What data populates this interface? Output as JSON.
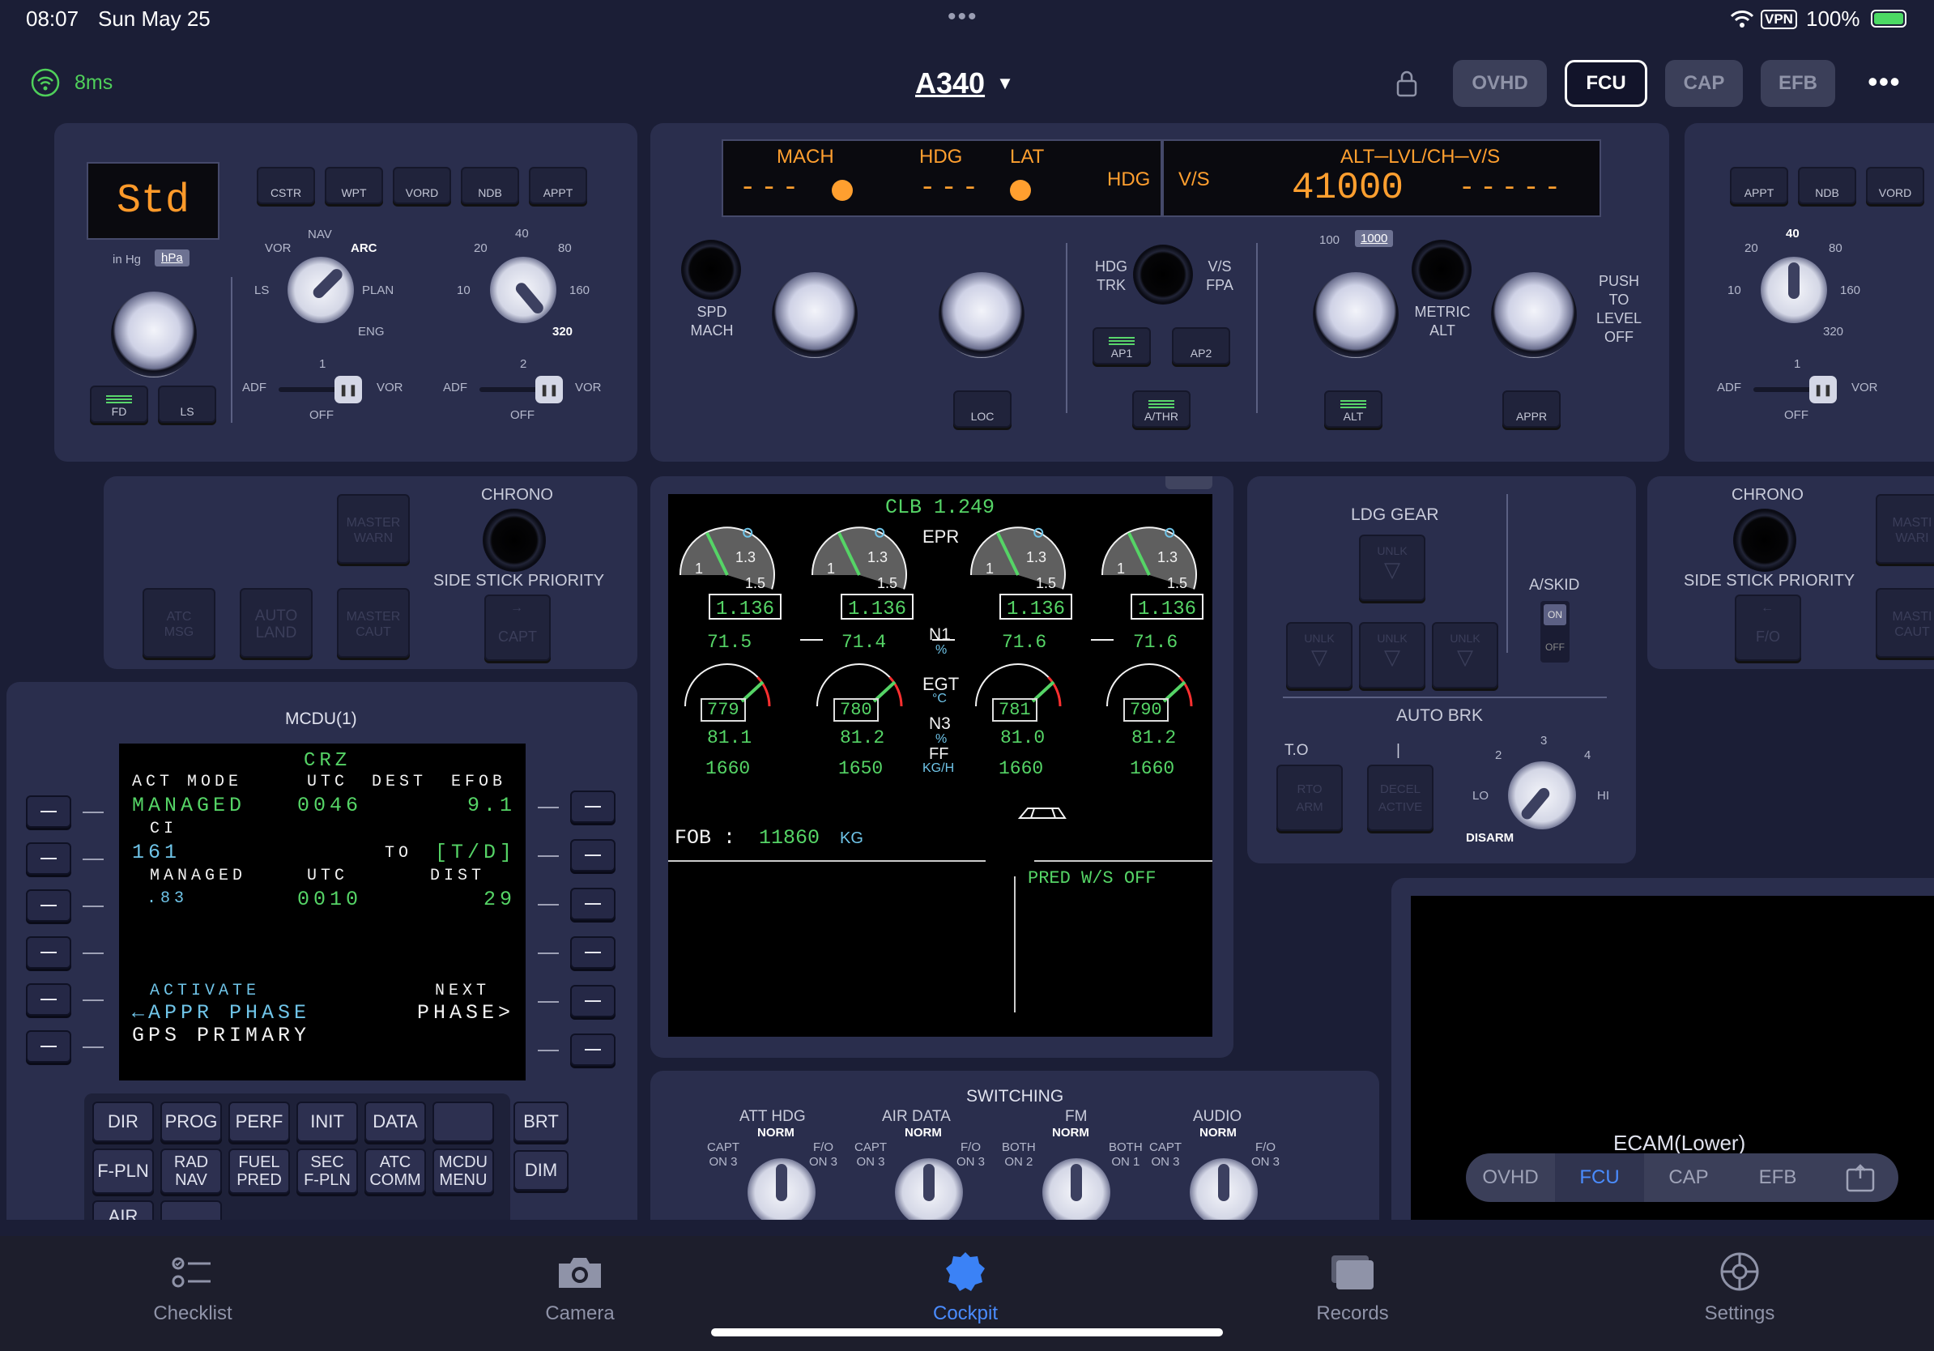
{
  "status_bar": {
    "time": "08:07",
    "date": "Sun May 25",
    "vpn": "VPN",
    "battery": "100%"
  },
  "header": {
    "latency": "8ms",
    "aircraft": "A340",
    "tabs": [
      {
        "label": "OVHD",
        "active": false
      },
      {
        "label": "FCU",
        "active": true
      },
      {
        "label": "CAP",
        "active": false
      },
      {
        "label": "EFB",
        "active": false
      }
    ]
  },
  "efis_left": {
    "baro_display": "Std",
    "baro_units": [
      "in Hg",
      "hPa"
    ],
    "buttons": [
      "CSTR",
      "WPT",
      "VORD",
      "NDB",
      "APPT"
    ],
    "fd": "FD",
    "ls": "LS",
    "nd_mode_labels": [
      "VOR",
      "NAV",
      "ARC",
      "PLAN",
      "ENG",
      "LS"
    ],
    "nd_mode_selected": "ARC",
    "range_labels": [
      "20",
      "40",
      "80",
      "160",
      "320",
      "10"
    ],
    "range_selected": "320",
    "adf_vor_1": {
      "num": "1",
      "left": "ADF",
      "right": "VOR",
      "off": "OFF"
    },
    "adf_vor_2": {
      "num": "2",
      "left": "ADF",
      "right": "VOR",
      "off": "OFF"
    }
  },
  "fcu": {
    "display_left": {
      "mach": "MACH",
      "mach_val": "---",
      "hdg": "HDG",
      "lat": "LAT",
      "hdg_val": "---",
      "hdg2": "HDG",
      "vs": "V/S"
    },
    "display_right": {
      "header": "ALT─LVL/CH─V/S",
      "alt_val": "41000",
      "vs_val": "-----"
    },
    "spd_mach": "SPD\nMACH",
    "hdg_trk": "HDG\nTRK",
    "vs_fpa": "V/S\nFPA",
    "alt_units": [
      "100",
      "1000"
    ],
    "metric_alt": "METRIC\nALT",
    "push_level_off": "PUSH\nTO\nLEVEL\nOFF",
    "buttons": {
      "loc": "LOC",
      "ap1": "AP1",
      "ap2": "AP2",
      "athr": "A/THR",
      "alt": "ALT",
      "appr": "APPR"
    }
  },
  "efis_right": {
    "buttons": [
      "APPT",
      "NDB",
      "VORD"
    ],
    "range_labels": [
      "20",
      "40",
      "80",
      "160",
      "320",
      "10"
    ],
    "adf_vor_1": {
      "num": "1",
      "left": "ADF",
      "right": "VOR",
      "off": "OFF"
    }
  },
  "glare_left": {
    "master_warn": "MASTER\nWARN",
    "master_caut": "MASTER\nCAUT",
    "atc_msg": "ATC\nMSG",
    "auto_land": "AUTO\nLAND",
    "chrono": "CHRONO",
    "ssp": "SIDE STICK PRIORITY",
    "capt": "CAPT"
  },
  "glare_right": {
    "chrono": "CHRONO",
    "ssp": "SIDE STICK PRIORITY",
    "fo": "F/O",
    "master_warn": "MASTI\nWARI",
    "master_caut": "MASTI\nCAUT"
  },
  "ewd": {
    "thrust": "CLB 1.249",
    "epr_label": "EPR",
    "epr_values": [
      "1.136",
      "1.136",
      "1.136",
      "1.136"
    ],
    "epr_scale": [
      "1",
      "1.3",
      "1.5"
    ],
    "n1_values": [
      "71.5",
      "71.4",
      "71.6",
      "71.6"
    ],
    "n1_label": "N1",
    "pct": "%",
    "egt_label": "EGT",
    "egt_unit": "°C",
    "egt_values": [
      "779",
      "780",
      "781",
      "790"
    ],
    "n3_label": "N3",
    "n3_values": [
      "81.1",
      "81.2",
      "81.0",
      "81.2"
    ],
    "ff_label": "FF",
    "ff_unit": "KG/H",
    "ff_values": [
      "1660",
      "1650",
      "1660",
      "1660"
    ],
    "fob_label": "FOB :",
    "fob_value": "11860",
    "fob_unit": "KG",
    "memo": "PRED W/S OFF"
  },
  "mcdu": {
    "title": "MCDU(1)",
    "lines": {
      "title": "CRZ",
      "l1_label": "ACT MODE",
      "l1_utc": "UTC",
      "l1_dest": "DEST",
      "l1_efob": "EFOB",
      "l1_val": "MANAGED",
      "l1_time": "0046",
      "l1_efob_val": "9.1",
      "l2_label": "CI",
      "l2_val": "161",
      "l2_to": "TO",
      "l2_td": "[T/D]",
      "l3_label": "MANAGED",
      "l3_utc": "UTC",
      "l3_dist": "DIST",
      "l3_val": ".83",
      "l3_time": "0010",
      "l3_dist_val": "29",
      "l6_label": "ACTIVATE",
      "l6_next": "NEXT",
      "l6_val": "←APPR PHASE",
      "l6_r": "PHASE>",
      "scratch": "GPS PRIMARY"
    },
    "keys": [
      {
        "label": "DIR"
      },
      {
        "label": "PROG"
      },
      {
        "label": "PERF"
      },
      {
        "label": "INIT"
      },
      {
        "label": "DATA"
      },
      {
        "label": ""
      },
      {
        "label": "F-PLN"
      },
      {
        "label": "RAD\nNAV"
      },
      {
        "label": "FUEL\nPRED"
      },
      {
        "label": "SEC\nF-PLN"
      },
      {
        "label": "ATC\nCOMM"
      },
      {
        "label": "MCDU\nMENU"
      }
    ],
    "brt": "BRT",
    "dim": "DIM",
    "air": "AIR"
  },
  "gear": {
    "title": "LDG GEAR",
    "unlk": "UNLK",
    "askid": "A/SKID",
    "on": "ON",
    "off": "OFF",
    "autobrk": "AUTO BRK",
    "to": "T.O",
    "rto": "RTO\nARM",
    "decel": "DECEL\nACTIVE",
    "bar": "|",
    "dial": [
      "2",
      "3",
      "4",
      "LO",
      "HI",
      "DISARM"
    ]
  },
  "switching": {
    "title": "SWITCHING",
    "groups": [
      {
        "name": "ATT HDG",
        "norm": "NORM",
        "l": "CAPT\nON 3",
        "r": "F/O\nON 3"
      },
      {
        "name": "AIR DATA",
        "norm": "NORM",
        "l": "CAPT\nON 3",
        "r": "F/O\nON 3"
      },
      {
        "name": "FM",
        "norm": "NORM",
        "l": "BOTH\nON 2",
        "r": "BOTH\nON 1"
      },
      {
        "name": "AUDIO",
        "norm": "NORM",
        "l": "CAPT\nON 3",
        "r": "F/O\nON 3"
      }
    ]
  },
  "ecam_lower": {
    "title": "ECAM(Lower)",
    "tabs": [
      "OVHD",
      "FCU",
      "CAP",
      "EFB"
    ],
    "active": "FCU"
  },
  "bottom_nav": [
    {
      "label": "Checklist",
      "active": false
    },
    {
      "label": "Camera",
      "active": false
    },
    {
      "label": "Cockpit",
      "active": true
    },
    {
      "label": "Records",
      "active": false
    },
    {
      "label": "Settings",
      "active": false
    }
  ]
}
